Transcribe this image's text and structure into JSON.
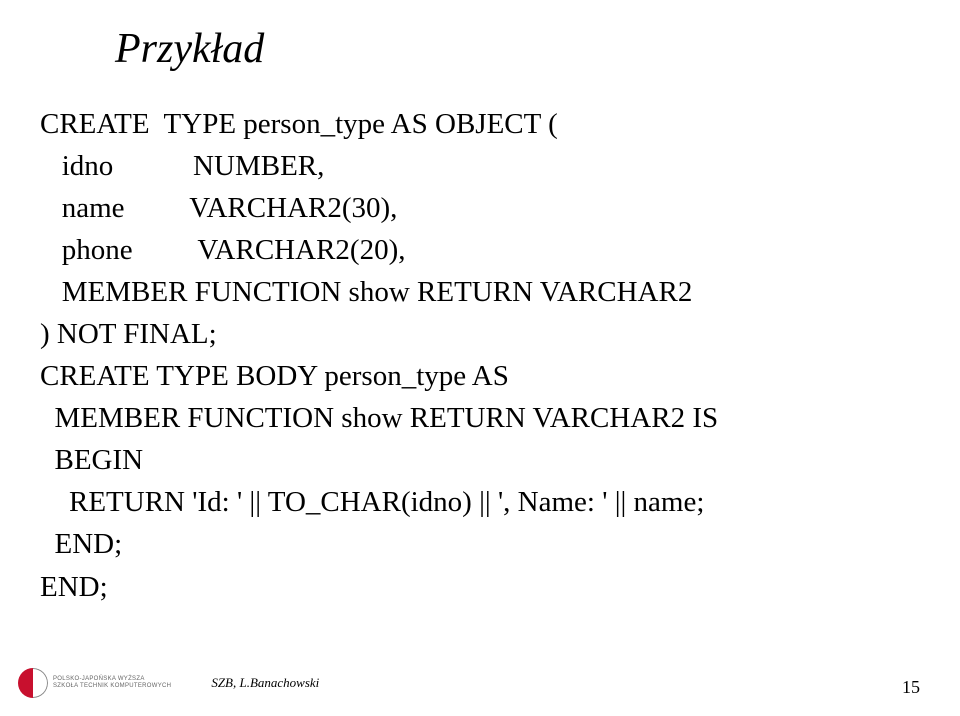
{
  "title": "Przykład",
  "code": {
    "line1": "CREATE  TYPE person_type AS OBJECT (",
    "line2": "   idno           NUMBER,",
    "line3": "   name         VARCHAR2(30),",
    "line4": "   phone         VARCHAR2(20),",
    "line5": "   MEMBER FUNCTION show RETURN VARCHAR2",
    "line6": ") NOT FINAL;",
    "line7": "CREATE TYPE BODY person_type AS",
    "line8": "  MEMBER FUNCTION show RETURN VARCHAR2 IS",
    "line9": "  BEGIN",
    "line10": "    RETURN 'Id: ' || TO_CHAR(idno) || ', Name: ' || name;",
    "line11": "  END;",
    "line12": "END;"
  },
  "footer": {
    "logo_text_line1": "POLSKO-JAPOŃSKA WYŻSZA",
    "logo_text_line2": "SZKOŁA TECHNIK KOMPUTEROWYCH",
    "author": "SZB, L.Banachowski",
    "page_number": "15"
  }
}
